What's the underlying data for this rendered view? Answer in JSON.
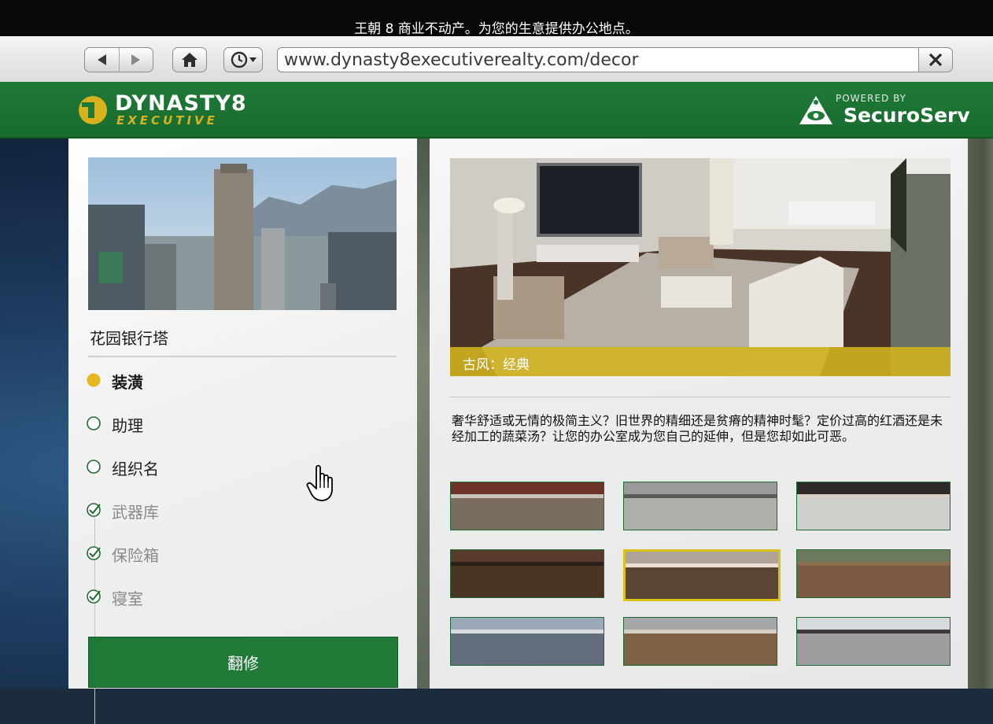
{
  "window": {
    "title": "王朝 8 商业不动产。为您的生意提供办公地点。"
  },
  "browser": {
    "url": "www.dynasty8executiverealty.com/decor",
    "icons": {
      "back": "back-arrow-icon",
      "forward": "forward-arrow-icon",
      "home": "home-icon",
      "history": "clock-history-icon",
      "close": "close-x-icon"
    }
  },
  "header": {
    "logo_line1": "DYNASTY8",
    "logo_line2": "EXECUTIVE",
    "powered_by": "POWERED BY",
    "partner": "SecuroServ",
    "colors": {
      "brand_green": "#1f7a37",
      "brand_gold": "#d7b21e"
    }
  },
  "left": {
    "building_name": "花园银行塔",
    "steps": [
      {
        "label": "装潢",
        "state": "active"
      },
      {
        "label": "助理",
        "state": "pending"
      },
      {
        "label": "组织名",
        "state": "pending"
      },
      {
        "label": "武器库",
        "state": "done"
      },
      {
        "label": "保险箱",
        "state": "done"
      },
      {
        "label": "寝室",
        "state": "done"
      }
    ],
    "renovate_label": "翻修"
  },
  "right": {
    "style_caption": "古风：经典",
    "description": "奢华舒适或无情的极简主义？旧世界的精细还是贫瘠的精神时髦？定价过高的红酒还是未经加工的蔬菜汤？让您的办公室成为您自己的延伸，但是您却如此可恶。",
    "swatches": [
      {
        "top": "#6e3328",
        "stripe": "#c9c3bc",
        "bottom": "#7a6d5e",
        "selected": false
      },
      {
        "top": "#9b9a9a",
        "stripe": "#5a5a5a",
        "bottom": "#b1afaa",
        "selected": false
      },
      {
        "top": "#2e2a27",
        "stripe": "#d8d0c6",
        "bottom": "#cfcfcb",
        "selected": false
      },
      {
        "top": "#5a3a2a",
        "stripe": "#2d2018",
        "bottom": "#4a3524",
        "selected": false
      },
      {
        "top": "#b0a498",
        "stripe": "#e8e0d8",
        "bottom": "#5b4535",
        "selected": true
      },
      {
        "top": "#6c7a5c",
        "stripe": "#8a6e4e",
        "bottom": "#7a5a44",
        "selected": false
      },
      {
        "top": "#9aa8b8",
        "stripe": "#d9dde2",
        "bottom": "#636d7c",
        "selected": false
      },
      {
        "top": "#a7a7a9",
        "stripe": "#d6cfc4",
        "bottom": "#7d6246",
        "selected": false
      },
      {
        "top": "#d6d9de",
        "stripe": "#3e3a3a",
        "bottom": "#a09da0",
        "selected": false
      }
    ],
    "colors": {
      "selected_border": "#d9c21a",
      "caption_bg": "#d4b420"
    }
  }
}
